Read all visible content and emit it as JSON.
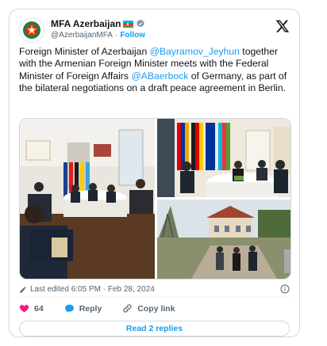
{
  "account": {
    "name": "MFA Azerbaijan",
    "handle": "@AzerbaijanMFA",
    "separator": "·",
    "follow_label": "Follow"
  },
  "tweet": {
    "text_1": "Foreign Minister of Azerbaijan ",
    "mention_1": "@Bayramov_Jeyhun",
    "text_2": " together with the Armenian Foreign Minister meets with the Federal Minister of Foreign Affairs ",
    "mention_2": "@ABaerbock",
    "text_3": " of Germany, as part of the bilateral negotiations on a draft peace agreement in Berlin."
  },
  "meta": {
    "edited": "Last edited 6:05 PM · Feb 28, 2024"
  },
  "actions": {
    "likes_count": "64",
    "reply_label": "Reply",
    "copy_link_label": "Copy link"
  },
  "replies": {
    "label": "Read 2 replies"
  },
  "colors": {
    "accent": "#1d9bf0",
    "like": "#f91880",
    "muted": "#536471"
  },
  "icons": [
    "emblem-icon",
    "flag-icon",
    "verified-icon",
    "x-logo-icon",
    "edit-pencil-icon",
    "info-icon",
    "heart-icon",
    "reply-icon",
    "link-icon"
  ]
}
